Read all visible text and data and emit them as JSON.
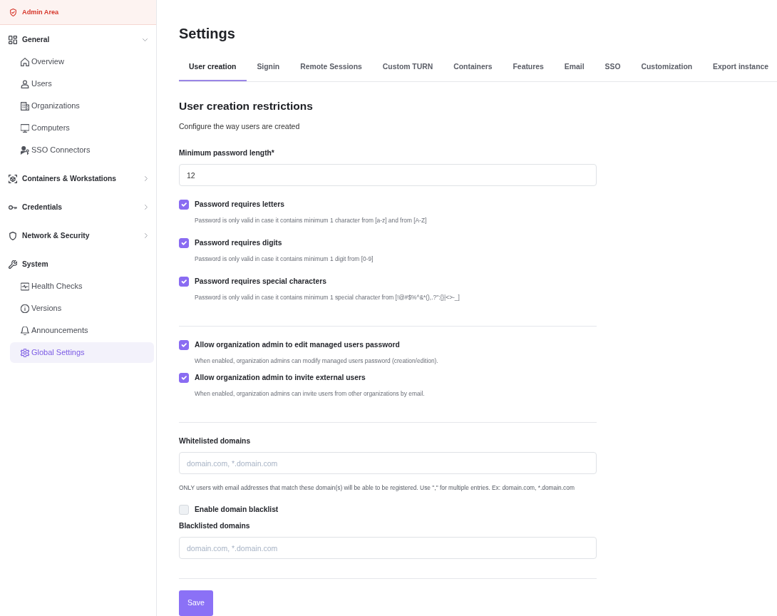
{
  "sidebar": {
    "header": "Admin Area",
    "sections": [
      {
        "label": "General",
        "kind": "collapsible",
        "expanded": true,
        "items": [
          {
            "label": "Overview",
            "selected": false
          },
          {
            "label": "Users",
            "selected": false
          },
          {
            "label": "Organizations",
            "selected": false
          },
          {
            "label": "Computers",
            "selected": false
          },
          {
            "label": "SSO Connectors",
            "selected": false
          }
        ]
      },
      {
        "label": "Containers & Workstations",
        "kind": "collapsible",
        "expanded": false
      },
      {
        "label": "Credentials",
        "kind": "collapsible",
        "expanded": false
      },
      {
        "label": "Network & Security",
        "kind": "collapsible",
        "expanded": false
      },
      {
        "label": "System",
        "kind": "static",
        "items": [
          {
            "label": "Health Checks",
            "selected": false
          },
          {
            "label": "Versions",
            "selected": false
          },
          {
            "label": "Announcements",
            "selected": false
          },
          {
            "label": "Global Settings",
            "selected": true
          }
        ]
      }
    ]
  },
  "page": {
    "title": "Settings"
  },
  "tabs": [
    {
      "label": "User creation",
      "selected": true
    },
    {
      "label": "Signin",
      "selected": false
    },
    {
      "label": "Remote Sessions",
      "selected": false
    },
    {
      "label": "Custom TURN",
      "selected": false
    },
    {
      "label": "Containers",
      "selected": false
    },
    {
      "label": "Features",
      "selected": false
    },
    {
      "label": "Email",
      "selected": false
    },
    {
      "label": "SSO",
      "selected": false
    },
    {
      "label": "Customization",
      "selected": false
    },
    {
      "label": "Export instance",
      "selected": false
    }
  ],
  "form": {
    "title": "User creation restrictions",
    "subtitle": "Configure the way users are created",
    "groups": [
      {
        "items": [
          {
            "kind": "field",
            "label": "Minimum password length*",
            "value": "12"
          },
          {
            "kind": "checkbox",
            "label": "Password requires letters",
            "description": "Password is only valid in case it contains minimum 1 character from [a-z] and from [A-Z]",
            "checked": true
          },
          {
            "kind": "checkbox",
            "label": "Password requires digits",
            "description": "Password is only valid in case it contains minimum 1 digit from [0-9]",
            "checked": true
          },
          {
            "kind": "checkbox",
            "label": "Password requires special characters",
            "description": "Password is only valid in case it contains minimum 1 special character from [!@#$%^&*(),.?\":{}|<>-_]",
            "checked": true
          }
        ]
      },
      {
        "items": [
          {
            "kind": "checkbox",
            "label": "Allow organization admin to edit managed users password",
            "description": "When enabled, organization admins can modify managed users password (creation/edition).",
            "checked": true
          },
          {
            "kind": "checkbox",
            "label": "Allow organization admin to invite external users",
            "description": "When enabled, organization admins can invite users from other organizations by email.",
            "checked": true
          }
        ]
      },
      {
        "items": [
          {
            "kind": "field",
            "label": "Whitelisted domains",
            "placeholder": "domain.com, *.domain.com",
            "help": "ONLY users with email addresses that match these domain(s) will be able to be registered. Use \",\" for multiple entries. Ex: domain.com, *.domain.com"
          },
          {
            "kind": "checkbox",
            "label": "Enable domain blacklist",
            "checked": false
          },
          {
            "kind": "field",
            "label": "Blacklisted domains",
            "placeholder": "domain.com, *.domain.com"
          }
        ]
      }
    ],
    "save_button": "Save"
  }
}
